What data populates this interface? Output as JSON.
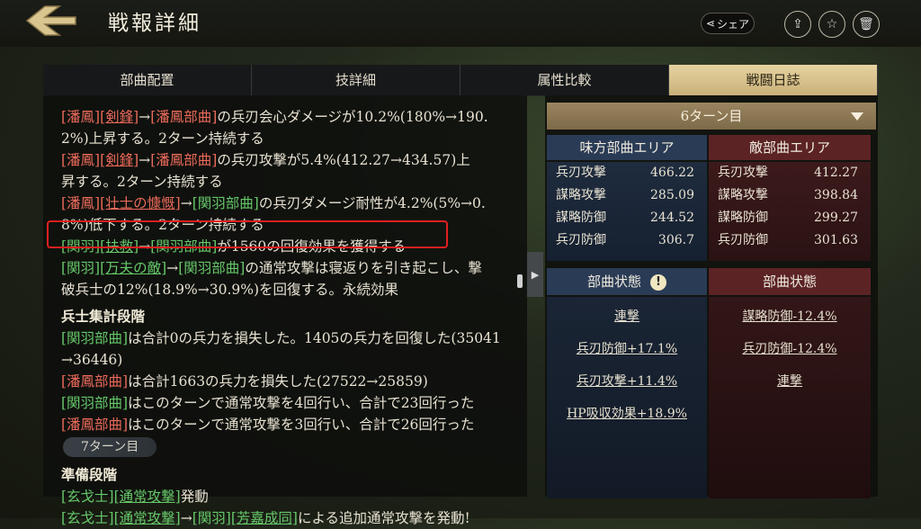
{
  "header": {
    "title": "戦報詳細",
    "share_label": "シェア"
  },
  "tabs": [
    "部曲配置",
    "技詳細",
    "属性比較",
    "戦闘日誌"
  ],
  "log": {
    "lines": [
      [
        [
          "r",
          "[潘鳳]"
        ],
        [
          "r u",
          "[剣鋒]"
        ],
        [
          "w",
          "→"
        ],
        [
          "r",
          "[潘鳳部曲]"
        ],
        [
          "w",
          "の兵刃会心ダメージが10.2%(180%→190."
        ]
      ],
      [
        [
          "w",
          "2%)上昇する。2ターン持続する"
        ]
      ],
      [
        [
          "r",
          "[潘鳳]"
        ],
        [
          "r u",
          "[剣鋒]"
        ],
        [
          "w",
          "→"
        ],
        [
          "r",
          "[潘鳳部曲]"
        ],
        [
          "w",
          "の兵刃攻撃が5.4%(412.27→434.57)上"
        ]
      ],
      [
        [
          "w",
          "昇する。2ターン持続する"
        ]
      ],
      [
        [
          "r",
          "[潘鳳]"
        ],
        [
          "r u",
          "[壮士の慷慨]"
        ],
        [
          "w",
          "→"
        ],
        [
          "g",
          "[関羽部曲]"
        ],
        [
          "w",
          "の兵刃ダメージ耐性が4.2%(5%→0."
        ]
      ],
      [
        [
          "w",
          "8%)低下する。2ターン持続する"
        ]
      ],
      [
        [
          "g",
          "[関羽]"
        ],
        [
          "g u",
          "[扶救]"
        ],
        [
          "w",
          "→"
        ],
        [
          "g",
          "[関羽部曲]"
        ],
        [
          "w",
          "が1560の回復効果を獲得する"
        ]
      ],
      [
        [
          "g",
          "[関羽]"
        ],
        [
          "g u",
          "[万夫の敵]"
        ],
        [
          "w",
          "→"
        ],
        [
          "g",
          "[関羽部曲]"
        ],
        [
          "w",
          "の通常攻撃は寝返りを引き起こし、撃"
        ]
      ],
      [
        [
          "w",
          "破兵士の12%(18.9%→30.9%)を回復する。永続効果"
        ]
      ]
    ],
    "section1": "兵士集計段階",
    "summary": [
      [
        [
          "g",
          "[関羽部曲]"
        ],
        [
          "w",
          "は合計0の兵力を損失した。1405の兵力を回復した(35041"
        ]
      ],
      [
        [
          "w",
          "→36446)"
        ]
      ],
      [
        [
          "r",
          "[潘鳳部曲]"
        ],
        [
          "w",
          "は合計1663の兵力を損失した(27522→25859)"
        ]
      ],
      [
        [
          "g",
          "[関羽部曲]"
        ],
        [
          "w",
          "はこのターンで通常攻撃を4回行い、合計で23回行った"
        ]
      ],
      [
        [
          "r",
          "[潘鳳部曲]"
        ],
        [
          "w",
          "はこのターンで通常攻撃を3回行い、合計で26回行った"
        ]
      ]
    ],
    "turn_label": "7ターン目",
    "section2": "準備段階",
    "prep": [
      [
        [
          "g",
          "[玄戈士]"
        ],
        [
          "g u",
          "[通常攻撃]"
        ],
        [
          "w",
          "発動"
        ]
      ],
      [
        [
          "g",
          "[玄戈士]"
        ],
        [
          "g u",
          "[通常攻撃]"
        ],
        [
          "w",
          "→"
        ],
        [
          "g",
          "[関羽]"
        ],
        [
          "g u",
          "[芳嘉成同]"
        ],
        [
          "w",
          "による追加通常攻撃を発動!"
        ]
      ]
    ]
  },
  "right": {
    "turn_select": "6ターン目",
    "ally_area": "味方部曲エリア",
    "enemy_area": "敵部曲エリア",
    "ally_stats": [
      [
        "兵刃攻撃",
        "466.22"
      ],
      [
        "謀略攻撃",
        "285.09"
      ],
      [
        "謀略防御",
        "244.52"
      ],
      [
        "兵刃防御",
        "306.7"
      ]
    ],
    "enemy_stats": [
      [
        "兵刃攻撃",
        "412.27"
      ],
      [
        "謀略攻撃",
        "398.84"
      ],
      [
        "謀略防御",
        "299.27"
      ],
      [
        "兵刃防御",
        "301.63"
      ]
    ],
    "status_label": "部曲状態",
    "ally_status": [
      "連撃",
      "兵刃防御+17.1%",
      "兵刃攻撃+11.4%",
      "HP吸収効果+18.9%"
    ],
    "enemy_status": [
      "謀略防御-12.4%",
      "兵刃防御-12.4%",
      "連撃"
    ]
  }
}
